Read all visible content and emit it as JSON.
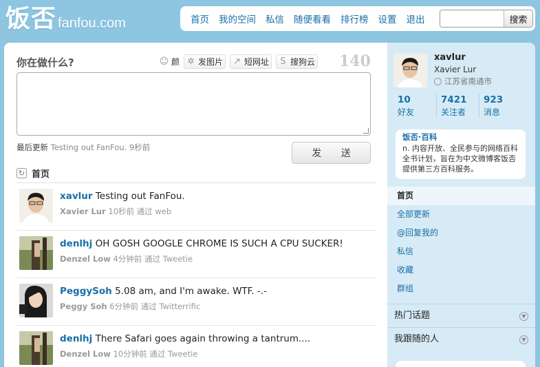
{
  "logo": {
    "cn": "饭否",
    "en": "fanfou.com"
  },
  "nav": {
    "items": [
      "首页",
      "我的空间",
      "私信",
      "随便看看",
      "排行榜",
      "设置",
      "退出"
    ],
    "search_button": "搜索",
    "search_value": ""
  },
  "compose": {
    "title": "你在做什么?",
    "emoticon_label": "颜",
    "photo_label": "发图片",
    "shorturl_label": "短网址",
    "sogou_label": "搜狗云",
    "counter": "140",
    "last_update_label": "最后更新",
    "last_update_text": "Testing out FanFou.",
    "last_update_time": "9秒前",
    "send_label": "发 送"
  },
  "timeline": {
    "title": "首页",
    "statuses": [
      {
        "user": "xavlur",
        "text": "Testing out FanFou.",
        "name": "Xavier Lur",
        "time": "10秒前",
        "via": "通过 web"
      },
      {
        "user": "denlhj",
        "text": "OH GOSH GOOGLE CHROME IS SUCH A CPU SUCKER!",
        "name": "Denzel Low",
        "time": "4分钟前",
        "via": "通过 Tweetie"
      },
      {
        "user": "PeggySoh",
        "text": "5.08 am, and I'm awake. WTF. -.-",
        "name": "Peggy Soh",
        "time": "6分钟前",
        "via": "通过 Twitterrific"
      },
      {
        "user": "denlhj",
        "text": "There Safari goes again throwing a tantrum....",
        "name": "Denzel Low",
        "time": "10分钟前",
        "via": "通过 Tweetie"
      }
    ]
  },
  "profile": {
    "username": "xavlur",
    "realname": "Xavier Lur",
    "location": "江苏省南通市",
    "stats": [
      {
        "num": "10",
        "label": "好友"
      },
      {
        "num": "7421",
        "label": "关注者"
      },
      {
        "num": "923",
        "label": "消息"
      }
    ]
  },
  "wiki": {
    "title": "饭否·百科",
    "body": "n. 内容开放、全民参与的网络百科全书计划，旨在为中文微博客饭否提供第三方百科服务。"
  },
  "menu": [
    "首页",
    "全部更新",
    "@回复我的",
    "私信",
    "收藏",
    "群组"
  ],
  "sections": [
    "热门话题",
    "我跟随的人"
  ],
  "colors": {
    "background": "#8ec5e0",
    "link": "#1a6fa6",
    "sidebar": "#d7ebf6"
  }
}
